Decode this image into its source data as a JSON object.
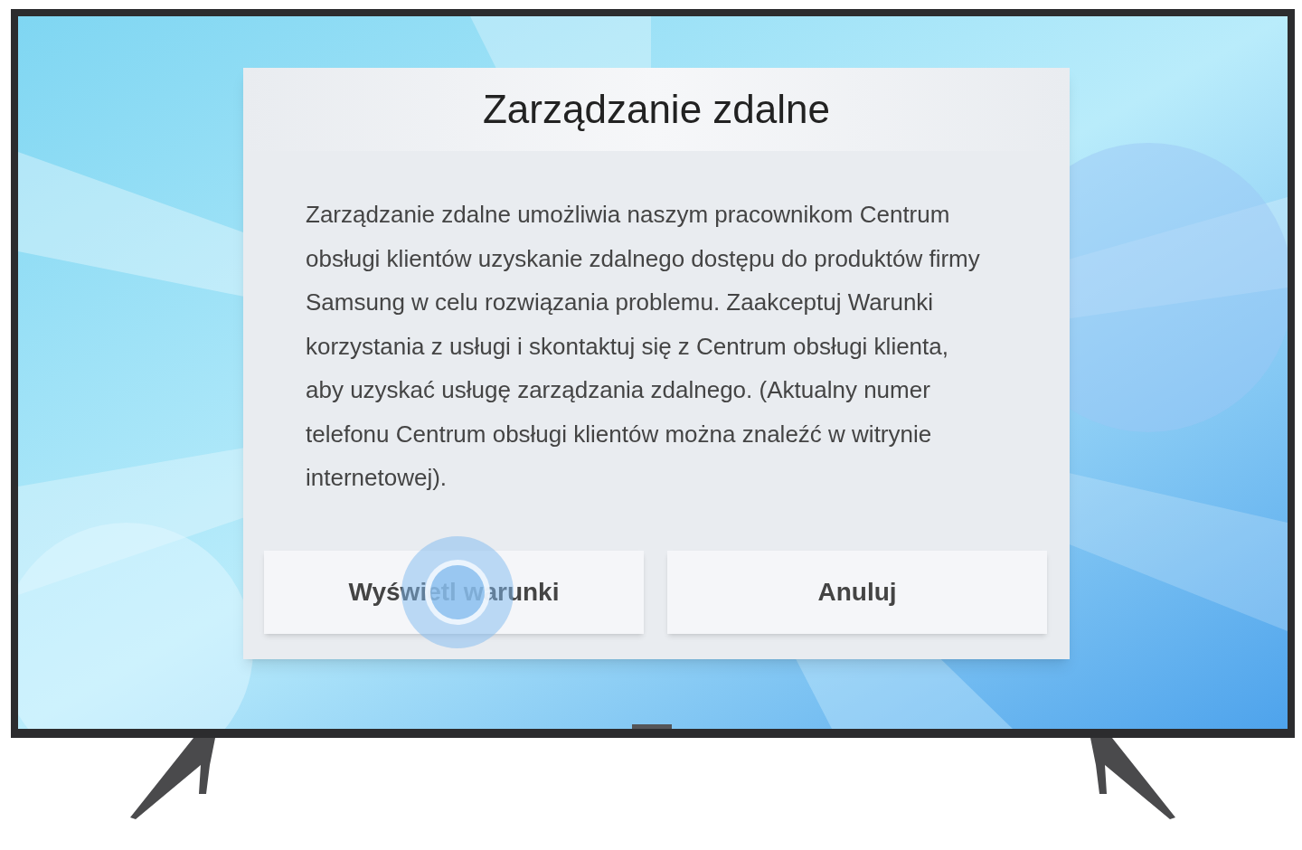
{
  "dialog": {
    "title": "Zarządzanie zdalne",
    "message": "Zarządzanie zdalne umożliwia naszym pracownikom Centrum obsługi klientów uzyskanie zdalnego dostępu do produktów firmy Samsung w celu rozwiązania problemu. Zaakceptuj Warunki korzystania z usługi i skontaktuj się z Centrum obsługi klienta, aby uzyskać usługę zarządzania zdalnego. (Aktualny numer telefonu Centrum obsługi klientów można znaleźć w witrynie internetowej).",
    "buttons": [
      {
        "label": "Wyświetl warunki",
        "touched": true
      },
      {
        "label": "Anuluj",
        "touched": false
      }
    ]
  }
}
